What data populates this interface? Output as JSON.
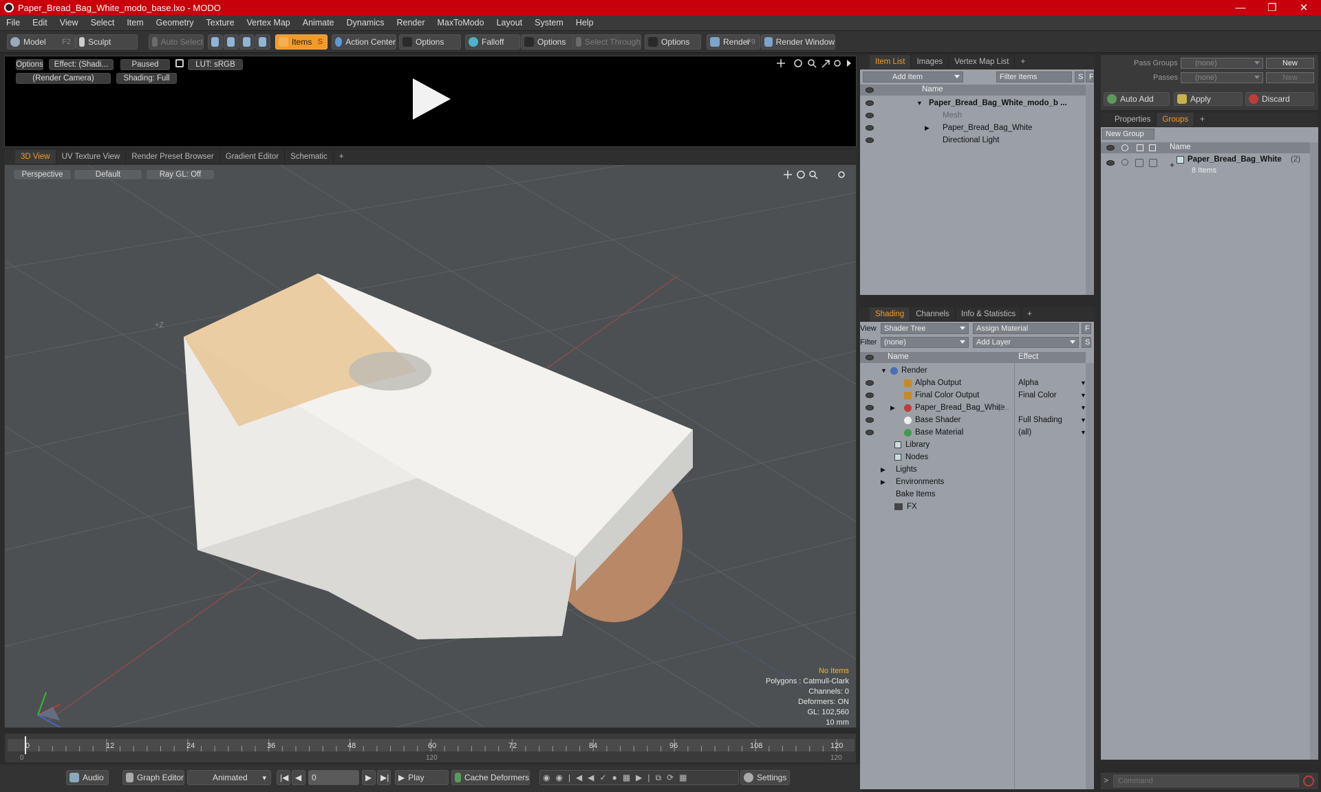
{
  "window": {
    "title": "Paper_Bread_Bag_White_modo_base.lxo - MODO",
    "controls": [
      "minimize",
      "maximize",
      "close"
    ]
  },
  "menu": [
    "File",
    "Edit",
    "View",
    "Select",
    "Item",
    "Geometry",
    "Texture",
    "Vertex Map",
    "Animate",
    "Dynamics",
    "Render",
    "MaxToModo",
    "Layout",
    "System",
    "Help"
  ],
  "toolbar": {
    "model": "Model",
    "model_key": "F2",
    "sculpt": "Sculpt",
    "auto_select": "Auto Select",
    "items": "Items",
    "items_key": "S",
    "action_center": "Action Center",
    "options1": "Options",
    "falloff": "Falloff",
    "options2": "Options",
    "select_through": "Select Through",
    "options3": "Options",
    "render": "Render",
    "render_key": "F9",
    "render_window": "Render Window"
  },
  "render_view": {
    "options": "Options",
    "effect": "Effect: (Shadi...",
    "paused": "Paused",
    "lut": "LUT: sRGB",
    "camera": "(Render Camera)",
    "shading": "Shading: Full"
  },
  "view_tabs": [
    "3D View",
    "UV Texture View",
    "Render Preset Browser",
    "Gradient Editor",
    "Schematic",
    "+"
  ],
  "viewport": {
    "projection": "Perspective",
    "style": "Default",
    "raygl": "Ray GL: Off",
    "axis_z_label": "+Z",
    "hud": {
      "selection": "No Items",
      "polygons": "Polygons : Catmull-Clark",
      "channels": "Channels: 0",
      "deformers": "Deformers: ON",
      "gl": "GL: 102,560",
      "scale": "10 mm"
    },
    "accent": "#f39b2a"
  },
  "timeline": {
    "ticks": [
      "0",
      "12",
      "24",
      "36",
      "48",
      "60",
      "72",
      "84",
      "96",
      "108",
      "120"
    ],
    "start": "0",
    "mid": "120",
    "end": "120"
  },
  "transport": {
    "audio": "Audio",
    "graph_editor": "Graph Editor",
    "mode": "Animated",
    "frame": "0",
    "play": "Play",
    "cache": "Cache Deformers",
    "settings": "Settings"
  },
  "item_list": {
    "tabs": [
      "Item List",
      "Images",
      "Vertex Map List",
      "+"
    ],
    "add_item": "Add Item",
    "filter": "Filter Items",
    "s_btn": "S",
    "f_btn": "F",
    "col_name": "Name",
    "rows": [
      {
        "label": "Paper_Bread_Bag_White_modo_b ...",
        "bold": true
      },
      {
        "label": "Mesh",
        "dim": true
      },
      {
        "label": "Paper_Bread_Bag_White"
      },
      {
        "label": "Directional Light"
      }
    ]
  },
  "shading": {
    "tabs": [
      "Shading",
      "Channels",
      "Info & Statistics",
      "+"
    ],
    "view_label": "View",
    "view_value": "Shader Tree",
    "assign": "Assign Material",
    "f_btn": "F",
    "filter_label": "Filter",
    "filter_value": "(none)",
    "add_layer": "Add Layer",
    "s_btn": "S",
    "col_name": "Name",
    "col_effect": "Effect",
    "rows": [
      {
        "label": "Render",
        "effect": ""
      },
      {
        "label": "Alpha Output",
        "effect": "Alpha"
      },
      {
        "label": "Final Color Output",
        "effect": "Final Color"
      },
      {
        "label": "Paper_Bread_Bag_White",
        "suffix": "(I...",
        "effect": ""
      },
      {
        "label": "Base Shader",
        "effect": "Full Shading"
      },
      {
        "label": "Base Material",
        "effect": "(all)"
      },
      {
        "label": "Library",
        "effect": ""
      },
      {
        "label": "Nodes",
        "effect": ""
      },
      {
        "label": "Lights",
        "effect": ""
      },
      {
        "label": "Environments",
        "effect": ""
      },
      {
        "label": "Bake Items",
        "effect": ""
      },
      {
        "label": "FX",
        "effect": ""
      }
    ]
  },
  "groups": {
    "pass_groups_label": "Pass Groups",
    "pass_groups_value": "(none)",
    "passes_label": "Passes",
    "passes_value": "(none)",
    "new1": "New",
    "new2": "New",
    "auto_add": "Auto Add",
    "apply": "Apply",
    "discard": "Discard",
    "tabs": [
      "Properties",
      "Groups",
      "+"
    ],
    "new_group": "New Group",
    "col_name": "Name",
    "group_name": "Paper_Bread_Bag_White",
    "group_count": "(2)",
    "group_items": "8 Items"
  },
  "command": {
    "placeholder": "Command",
    "prompt": ">"
  }
}
